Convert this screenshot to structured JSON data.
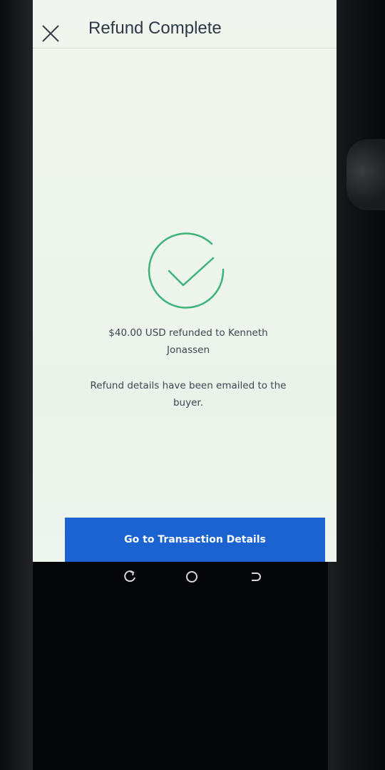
{
  "header": {
    "title": "Refund Complete",
    "close_icon": "close-icon"
  },
  "status": {
    "icon": "check-circle-icon",
    "icon_color": "#3bb37a"
  },
  "messages": {
    "refund_line1": "$40.00 USD refunded to Kenneth",
    "refund_line2": "Jonassen",
    "email_line1": "Refund details have been emailed to the",
    "email_line2": "buyer."
  },
  "actions": {
    "primary_label": "Go to Transaction Details",
    "primary_color": "#1a63d1"
  },
  "system_nav": {
    "recents_icon": "recents-icon",
    "home_icon": "home-icon",
    "back_icon": "back-icon"
  }
}
